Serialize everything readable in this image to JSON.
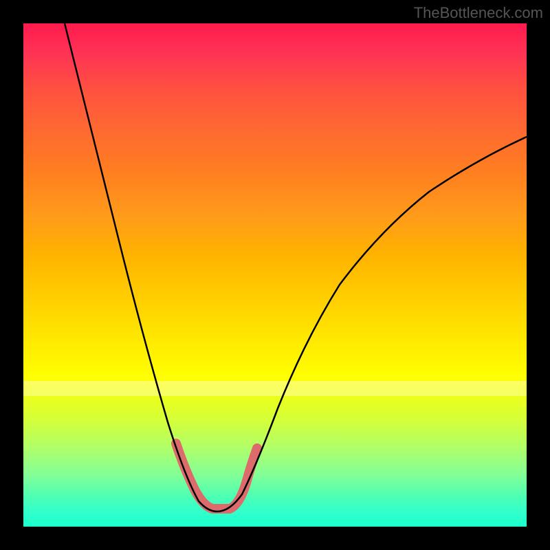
{
  "watermark": "TheBottleneck.com",
  "chart_data": {
    "type": "line",
    "title": "",
    "xlabel": "",
    "ylabel": "",
    "xlim": [
      0,
      100
    ],
    "ylim": [
      0,
      100
    ],
    "description": "V-shaped bottleneck curve over rainbow gradient background (red at top through yellow to green at bottom). The curve depicts a bottleneck metric that is worst at extremes and optimal near the minimum point around x≈37.",
    "series": [
      {
        "name": "curve",
        "x": [
          10,
          15,
          20,
          25,
          28,
          30,
          32,
          34,
          36,
          38,
          40,
          42,
          45,
          50,
          55,
          60,
          70,
          80,
          90,
          100
        ],
        "y": [
          100,
          82,
          63,
          42,
          28,
          18,
          10,
          4,
          1,
          1,
          3,
          8,
          16,
          28,
          38,
          46,
          58,
          66,
          71,
          74
        ]
      }
    ],
    "highlight": {
      "x_range": [
        30,
        42
      ],
      "y_range": [
        0,
        10
      ],
      "note": "Thick pink/coral stroke on the U-bottom segment indicating optimal zone"
    },
    "background_gradient": {
      "top_color": "#ff1a4d",
      "bottom_color": "#1affcc",
      "meaning": "red = bad / high bottleneck, green = good / low bottleneck"
    }
  }
}
